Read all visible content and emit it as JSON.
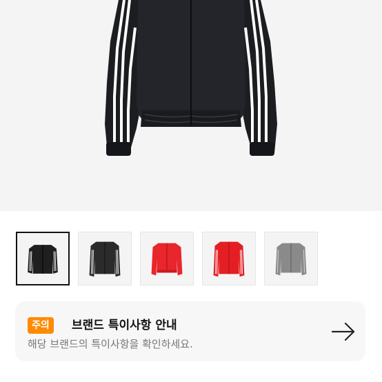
{
  "product_gallery": {
    "main_image": "black-track-jacket",
    "thumbnails": [
      {
        "name": "black-track-jacket",
        "color": "#1f1f1f",
        "selected": true
      },
      {
        "name": "black-track-jacket-alt",
        "color": "#2b2b2b",
        "selected": false
      },
      {
        "name": "red-track-jacket",
        "color": "#e8262b",
        "selected": false
      },
      {
        "name": "red-track-jacket-alt",
        "color": "#e41f24",
        "selected": false
      },
      {
        "name": "grey-track-jacket",
        "color": "#8a8a8a",
        "selected": false
      }
    ]
  },
  "brand_notice": {
    "badge": "주의",
    "title": "브랜드 특이사항 안내",
    "description": "해당 브랜드의 특이사항을 확인하세요.",
    "icon": "arrow-right-icon",
    "badge_color": "#ff8a00"
  }
}
